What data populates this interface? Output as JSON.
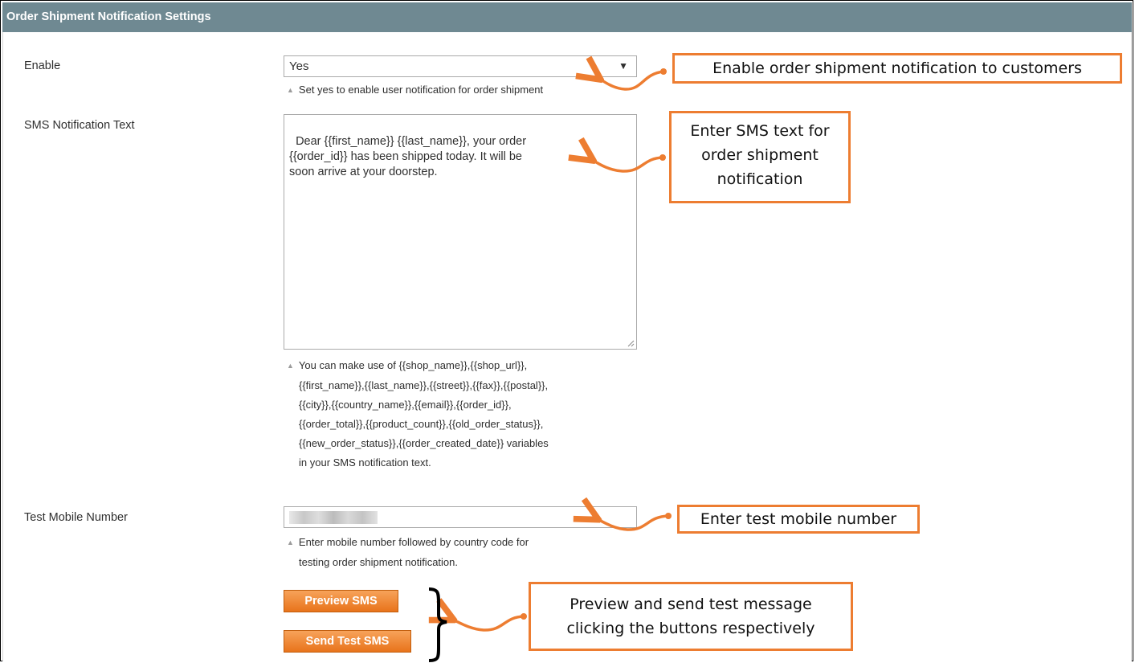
{
  "section": {
    "title": "Order Shipment Notification Settings"
  },
  "enable": {
    "label": "Enable",
    "value": "Yes",
    "note": "Set yes to enable user notification for order shipment"
  },
  "sms_text": {
    "label": "SMS Notification Text",
    "value": "Dear {{first_name}} {{last_name}}, your order\n{{order_id}} has been shipped today. It will be\nsoon arrive at your doorstep.",
    "note_lines": [
      "You can make use of {{shop_name}},{{shop_url}},",
      "{{first_name}},{{last_name}},{{street}},{{fax}},{{postal}},",
      "{{city}},{{country_name}},{{email}},{{order_id}},",
      "{{order_total}},{{product_count}},{{old_order_status}},",
      "{{new_order_status}},{{order_created_date}} variables",
      "in your SMS notification text."
    ]
  },
  "test_mobile": {
    "label": "Test Mobile Number",
    "note_lines": [
      "Enter mobile number followed by country code for",
      "testing order shipment notification."
    ]
  },
  "buttons": {
    "preview": "Preview SMS",
    "send_test": "Send Test SMS"
  },
  "callouts": {
    "enable": "Enable order shipment notification to customers",
    "sms_lines": [
      "Enter SMS text for",
      "order shipment",
      "notification"
    ],
    "mobile": "Enter test mobile number",
    "buttons_lines": [
      "Preview and send test message",
      "clicking the buttons respectively"
    ]
  },
  "colors": {
    "header_bg": "#6f8992",
    "accent": "#ed7d31",
    "button": "#e8731b"
  }
}
